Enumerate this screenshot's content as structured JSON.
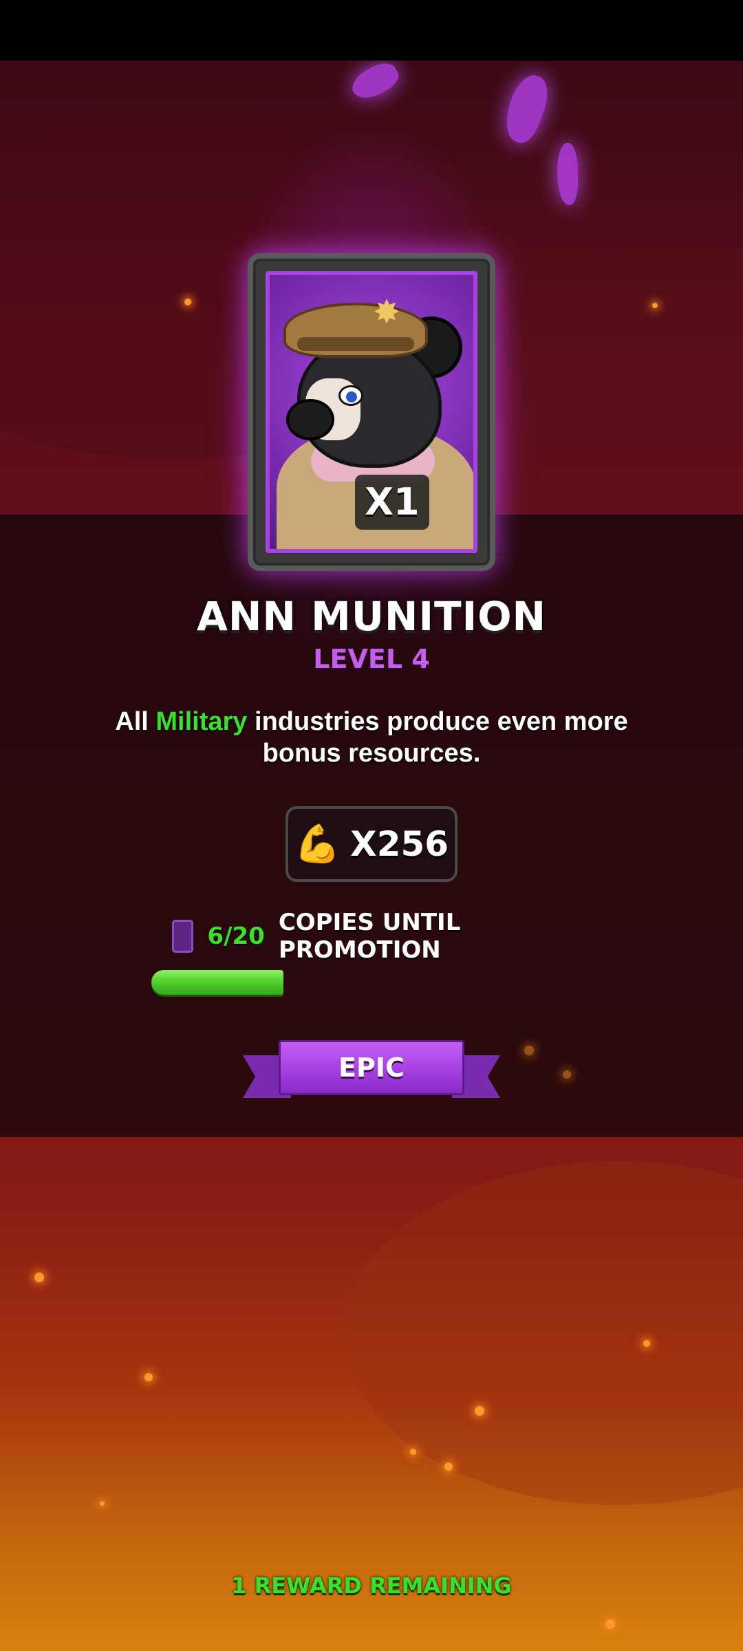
{
  "card": {
    "quantity": "X1",
    "name": "ANN MUNITION",
    "level": "LEVEL 4",
    "description_prefix": "All ",
    "description_highlight": "Military",
    "description_suffix": " industries produce even more bonus resources.",
    "power_icon": "flexed-biceps-icon",
    "power_value": "X256",
    "rarity": "EPIC"
  },
  "promotion": {
    "copies_count": "6/20",
    "copies_label": "COPIES UNTIL PROMOTION",
    "progress_fraction": 0.3
  },
  "footer": {
    "remaining": "1 REWARD REMAINING"
  },
  "colors": {
    "highlight_green": "#39e12b",
    "epic_purple": "#a43de0",
    "level_purple": "#c55ef0"
  }
}
